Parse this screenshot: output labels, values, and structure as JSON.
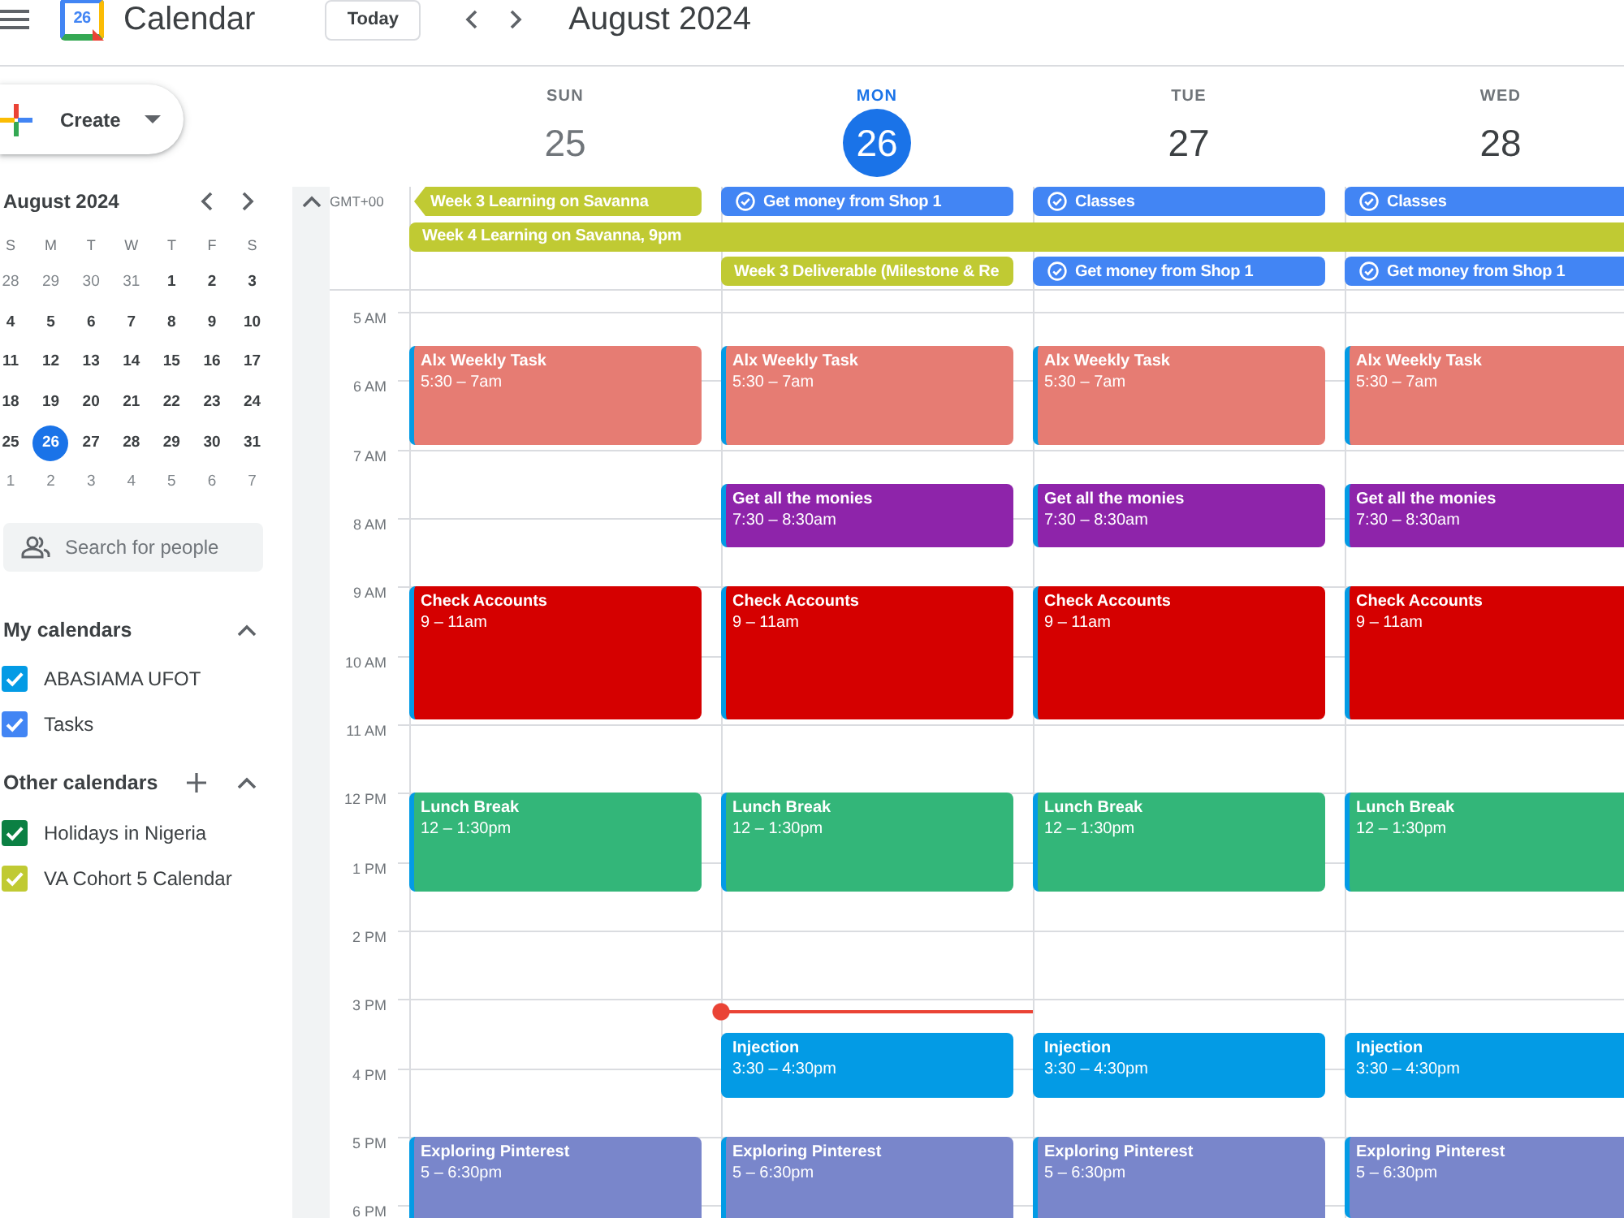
{
  "header": {
    "logo_date": "26",
    "title": "Calendar",
    "today_button": "Today",
    "period": "August 2024"
  },
  "sidebar": {
    "create_button": "Create",
    "mini_calendar": {
      "title": "August 2024",
      "weekdays": [
        "S",
        "M",
        "T",
        "W",
        "T",
        "F",
        "S"
      ],
      "days": [
        {
          "day": "28",
          "other_month": true,
          "selected": false
        },
        {
          "day": "29",
          "other_month": true,
          "selected": false
        },
        {
          "day": "30",
          "other_month": true,
          "selected": false
        },
        {
          "day": "31",
          "other_month": true,
          "selected": false
        },
        {
          "day": "1",
          "other_month": false,
          "selected": false
        },
        {
          "day": "2",
          "other_month": false,
          "selected": false
        },
        {
          "day": "3",
          "other_month": false,
          "selected": false
        },
        {
          "day": "4",
          "other_month": false,
          "selected": false
        },
        {
          "day": "5",
          "other_month": false,
          "selected": false
        },
        {
          "day": "6",
          "other_month": false,
          "selected": false
        },
        {
          "day": "7",
          "other_month": false,
          "selected": false
        },
        {
          "day": "8",
          "other_month": false,
          "selected": false
        },
        {
          "day": "9",
          "other_month": false,
          "selected": false
        },
        {
          "day": "10",
          "other_month": false,
          "selected": false
        },
        {
          "day": "11",
          "other_month": false,
          "selected": false
        },
        {
          "day": "12",
          "other_month": false,
          "selected": false
        },
        {
          "day": "13",
          "other_month": false,
          "selected": false
        },
        {
          "day": "14",
          "other_month": false,
          "selected": false
        },
        {
          "day": "15",
          "other_month": false,
          "selected": false
        },
        {
          "day": "16",
          "other_month": false,
          "selected": false
        },
        {
          "day": "17",
          "other_month": false,
          "selected": false
        },
        {
          "day": "18",
          "other_month": false,
          "selected": false
        },
        {
          "day": "19",
          "other_month": false,
          "selected": false
        },
        {
          "day": "20",
          "other_month": false,
          "selected": false
        },
        {
          "day": "21",
          "other_month": false,
          "selected": false
        },
        {
          "day": "22",
          "other_month": false,
          "selected": false
        },
        {
          "day": "23",
          "other_month": false,
          "selected": false
        },
        {
          "day": "24",
          "other_month": false,
          "selected": false
        },
        {
          "day": "25",
          "other_month": false,
          "selected": false
        },
        {
          "day": "26",
          "other_month": false,
          "selected": true
        },
        {
          "day": "27",
          "other_month": false,
          "selected": false
        },
        {
          "day": "28",
          "other_month": false,
          "selected": false
        },
        {
          "day": "29",
          "other_month": false,
          "selected": false
        },
        {
          "day": "30",
          "other_month": false,
          "selected": false
        },
        {
          "day": "31",
          "other_month": false,
          "selected": false
        },
        {
          "day": "1",
          "other_month": true,
          "selected": false
        },
        {
          "day": "2",
          "other_month": true,
          "selected": false
        },
        {
          "day": "3",
          "other_month": true,
          "selected": false
        },
        {
          "day": "4",
          "other_month": true,
          "selected": false
        },
        {
          "day": "5",
          "other_month": true,
          "selected": false
        },
        {
          "day": "6",
          "other_month": true,
          "selected": false
        },
        {
          "day": "7",
          "other_month": true,
          "selected": false
        }
      ]
    },
    "search": {
      "placeholder": "Search for people"
    },
    "my_calendars": {
      "title": "My calendars",
      "expanded": true,
      "items": [
        {
          "name": "ABASIAMA UFOT",
          "checked": true,
          "color": "#039be5"
        },
        {
          "name": "Tasks",
          "checked": true,
          "color": "#4285f4"
        }
      ]
    },
    "other_calendars": {
      "title": "Other calendars",
      "expanded": true,
      "items": [
        {
          "name": "Holidays in Nigeria",
          "checked": true,
          "color": "#0b8043"
        },
        {
          "name": "VA Cohort 5 Calendar",
          "checked": true,
          "color": "#c0ca33"
        }
      ]
    }
  },
  "week": {
    "days": [
      {
        "weekday": "SUN",
        "date": "25",
        "today": false,
        "past": true,
        "events": [
          {
            "title": "Alx Weekly Task",
            "time": "5:30 – 7am",
            "color": "#e67c73"
          },
          {
            "title": "Check Accounts",
            "time": "9 – 11am",
            "color": "#d50000"
          },
          {
            "title": "Lunch Break",
            "time": "12 – 1:30pm",
            "color": "#33b679"
          },
          {
            "title": "Exploring Pinterest",
            "time": "5 – 6:30pm",
            "color": "#7986cb"
          }
        ]
      },
      {
        "weekday": "MON",
        "date": "26",
        "today": true,
        "past": false,
        "events": [
          {
            "title": "Alx Weekly Task",
            "time": "5:30 – 7am",
            "color": "#e67c73"
          },
          {
            "title": "Get all the monies",
            "time": "7:30 – 8:30am",
            "color": "#8e24aa"
          },
          {
            "title": "Check Accounts",
            "time": "9 – 11am",
            "color": "#d50000"
          },
          {
            "title": "Lunch Break",
            "time": "12 – 1:30pm",
            "color": "#33b679"
          },
          {
            "title": "Injection",
            "time": "3:30 – 4:30pm",
            "color": "#039be5"
          },
          {
            "title": "Exploring Pinterest",
            "time": "5 – 6:30pm",
            "color": "#7986cb"
          }
        ]
      },
      {
        "weekday": "TUE",
        "date": "27",
        "today": false,
        "past": false,
        "events": [
          {
            "title": "Alx Weekly Task",
            "time": "5:30 – 7am",
            "color": "#e67c73"
          },
          {
            "title": "Get all the monies",
            "time": "7:30 – 8:30am",
            "color": "#8e24aa"
          },
          {
            "title": "Check Accounts",
            "time": "9 – 11am",
            "color": "#d50000"
          },
          {
            "title": "Lunch Break",
            "time": "12 – 1:30pm",
            "color": "#33b679"
          },
          {
            "title": "Injection",
            "time": "3:30 – 4:30pm",
            "color": "#039be5"
          },
          {
            "title": "Exploring Pinterest",
            "time": "5 – 6:30pm",
            "color": "#7986cb"
          }
        ]
      },
      {
        "weekday": "WED",
        "date": "28",
        "today": false,
        "past": false,
        "events": [
          {
            "title": "Alx Weekly Task",
            "time": "5:30 – 7am",
            "color": "#e67c73"
          },
          {
            "title": "Get all the monies",
            "time": "7:30 – 8:30am",
            "color": "#8e24aa"
          },
          {
            "title": "Check Accounts",
            "time": "9 – 11am",
            "color": "#d50000"
          },
          {
            "title": "Lunch Break",
            "time": "12 – 1:30pm",
            "color": "#33b679"
          },
          {
            "title": "Injection",
            "time": "3:30 – 4:30pm",
            "color": "#039be5"
          },
          {
            "title": "Exploring Pinterest",
            "time": "5 – 6:30pm",
            "color": "#7986cb"
          }
        ]
      }
    ],
    "timezone": "GMT+00",
    "all_day_rows": [
      [
        {
          "kind": "event",
          "title": "Week 3 Learning on Savanna",
          "color": "#c0ca33",
          "continued": true,
          "spans_rest": false
        },
        {
          "kind": "task",
          "title": "Get money from Shop 1",
          "color": "#4285f4",
          "continued": false,
          "spans_rest": false
        },
        {
          "kind": "task",
          "title": "Classes",
          "color": "#4285f4",
          "continued": false,
          "spans_rest": false
        },
        {
          "kind": "task",
          "title": "Classes",
          "color": "#4285f4",
          "continued": false,
          "spans_rest": false
        }
      ],
      [
        {
          "kind": "event",
          "title": "Week 4 Learning on Savanna, 9pm",
          "color": "#c0ca33",
          "continued": false,
          "spans_rest": true
        }
      ],
      [
        null,
        {
          "kind": "event",
          "title": "Week 3 Deliverable (Milestone & Re",
          "color": "#c0ca33",
          "continued": false,
          "spans_rest": false
        },
        {
          "kind": "task",
          "title": "Get money from Shop 1",
          "color": "#4285f4",
          "continued": false,
          "spans_rest": false
        },
        {
          "kind": "task",
          "title": "Get money from Shop 1",
          "color": "#4285f4",
          "continued": false,
          "spans_rest": false
        }
      ]
    ],
    "hours": [
      "5 AM",
      "6 AM",
      "7 AM",
      "8 AM",
      "9 AM",
      "10 AM",
      "11 AM",
      "12 PM",
      "1 PM",
      "2 PM",
      "3 PM",
      "4 PM",
      "5 PM",
      "6 PM"
    ]
  }
}
